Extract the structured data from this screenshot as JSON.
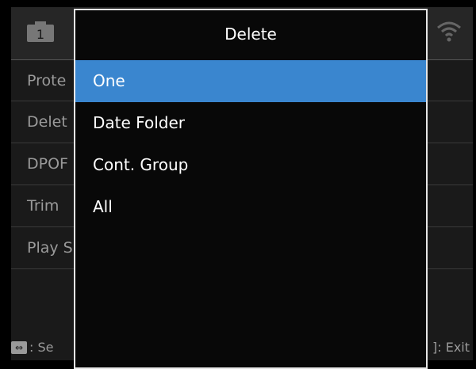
{
  "background_screen": {
    "menu_items": [
      "Prote",
      "Delet",
      "DPOF",
      "Trim",
      "Play S"
    ],
    "tab_playback_number": "1",
    "footer_left_key": "⇔",
    "footer_left_text": ": Se",
    "footer_right_text": "]: Exit"
  },
  "dialog": {
    "title": "Delete",
    "options": [
      "One",
      "Date Folder",
      "Cont. Group",
      "All"
    ],
    "selected_index": 0
  },
  "colors": {
    "highlight": "#3a86cf",
    "dialog_border": "#e6e6e6",
    "dim_text": "#9a9a9a"
  }
}
